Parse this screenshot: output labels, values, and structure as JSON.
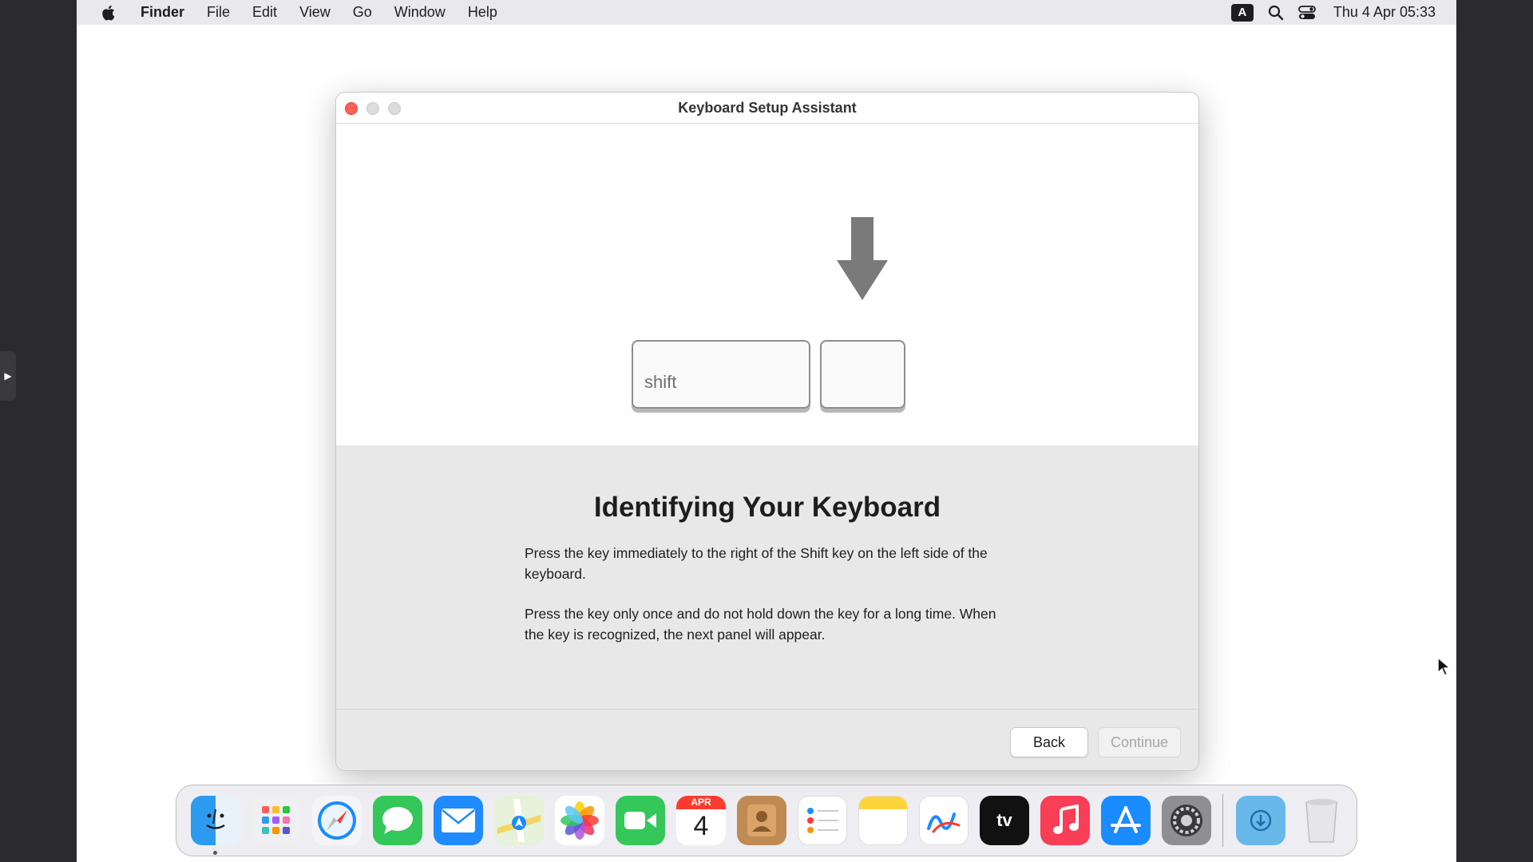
{
  "menubar": {
    "app_name": "Finder",
    "items": [
      "File",
      "Edit",
      "View",
      "Go",
      "Window",
      "Help"
    ],
    "input_source": "A",
    "datetime": "Thu 4 Apr  05:33"
  },
  "window": {
    "title": "Keyboard Setup Assistant",
    "illustration": {
      "left_key_label": "shift",
      "arrow_icon": "down-arrow-icon"
    },
    "heading": "Identifying Your Keyboard",
    "paragraph1": "Press the key immediately to the right of the Shift key on the left side of the keyboard.",
    "paragraph2": "Press the key only once and do not hold down the key for a long time. When the key is recognized, the next panel will appear.",
    "buttons": {
      "back": "Back",
      "continue": "Continue"
    }
  },
  "dock": {
    "calendar_month": "APR",
    "calendar_day": "4",
    "tv_label": "tv",
    "items": [
      "finder",
      "launchpad",
      "safari",
      "messages",
      "mail",
      "maps",
      "photos",
      "facetime",
      "calendar",
      "contacts",
      "reminders",
      "notes",
      "freeform",
      "tv",
      "music",
      "app-store",
      "system-settings",
      "downloads",
      "trash"
    ]
  },
  "colors": {
    "close": "#ff5f57",
    "dock_bg": "#ebebf0",
    "panel_bg": "#e8e8e8"
  }
}
